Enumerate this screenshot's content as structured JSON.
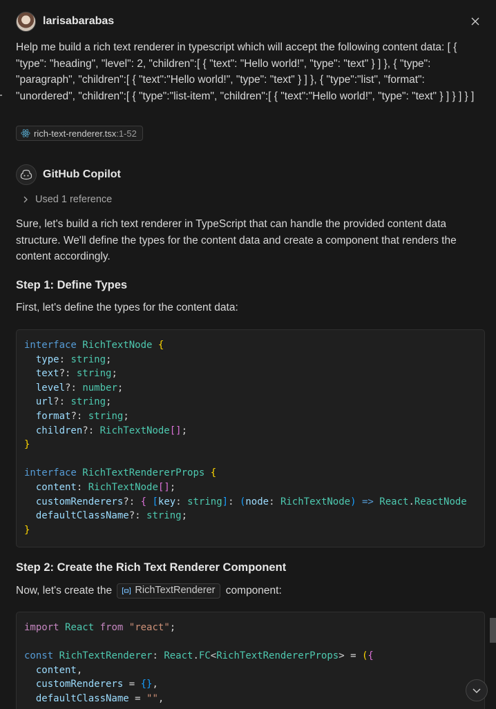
{
  "user": {
    "name": "larisabarabas",
    "prompt": "Help me build a rich text renderer in typescript which will accept the following content data: [ { \"type\": \"heading\", \"level\": 2, \"children\":[ { \"text\": \"Hello world!\", \"type\": \"text\" } ] }, { \"type\": \"paragraph\", \"children\":[ { \"text\":\"Hello world!\", \"type\": \"text\" } ] }, { \"type\":\"list\", \"format\": \"unordered\", \"children\":[ { \"type\":\"list-item\", \"children\":[ { \"text\":\"Hello world!\", \"type\": \"text\" } ] } ] } ]",
    "attachment": {
      "file": "rich-text-renderer.tsx",
      "lines": ":1-52",
      "icon": "react-atom-icon"
    }
  },
  "assistant": {
    "name": "GitHub Copilot",
    "references_label": "Used 1 reference",
    "intro": "Sure, let's build a rich text renderer in TypeScript that can handle the provided content data structure. We'll define the types for the content data and create a component that renders the content accordingly.",
    "step1_heading": "Step 1: Define Types",
    "step1_text": "First, let's define the types for the content data:",
    "step2_heading": "Step 2: Create the Rich Text Renderer Component",
    "step2_text_before": "Now, let's create the",
    "step2_inline_symbol": "RichTextRenderer",
    "step2_text_after": "component:"
  },
  "code1": [
    "interface RichTextNode {",
    "  type: string;",
    "  text?: string;",
    "  level?: number;",
    "  url?: string;",
    "  format?: string;",
    "  children?: RichTextNode[];",
    "}",
    "",
    "interface RichTextRendererProps {",
    "  content: RichTextNode[];",
    "  customRenderers?: { [key: string]: (node: RichTextNode) => React.ReactNode",
    "  defaultClassName?: string;",
    "}"
  ],
  "code2": [
    "import React from \"react\";",
    "",
    "const RichTextRenderer: React.FC<RichTextRendererProps> = ({",
    "  content,",
    "  customRenderers = {},",
    "  defaultClassName = \"\","
  ],
  "colors": {
    "background": "#181818",
    "code_background": "#1f1f1f",
    "keyword": "#569cd6",
    "type": "#4ec9b0",
    "property": "#9cdcfe",
    "string": "#ce9178"
  }
}
